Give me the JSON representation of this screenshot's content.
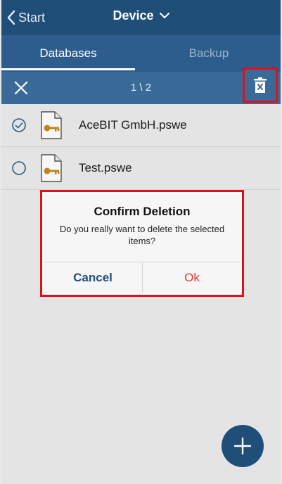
{
  "header": {
    "back_label": "Start",
    "title": "Device"
  },
  "tabs": [
    {
      "label": "Databases",
      "active": true
    },
    {
      "label": "Backup",
      "active": false
    }
  ],
  "selection": {
    "count_text": "1 \\ 2"
  },
  "files": [
    {
      "name": "AceBIT GmbH.pswe",
      "selected": true
    },
    {
      "name": "Test.pswe",
      "selected": false
    }
  ],
  "dialog": {
    "title": "Confirm Deletion",
    "message": "Do you really want to delete the selected items?",
    "cancel_label": "Cancel",
    "ok_label": "Ok"
  },
  "colors": {
    "header": "#1f4e79",
    "highlight": "#e0101a",
    "ok": "#e8382b"
  },
  "icons": {
    "back": "chevron-left-icon",
    "title_dropdown": "chevron-down-icon",
    "close": "close-icon",
    "delete": "trash-icon",
    "file": "key-file-icon",
    "add": "plus-icon"
  }
}
